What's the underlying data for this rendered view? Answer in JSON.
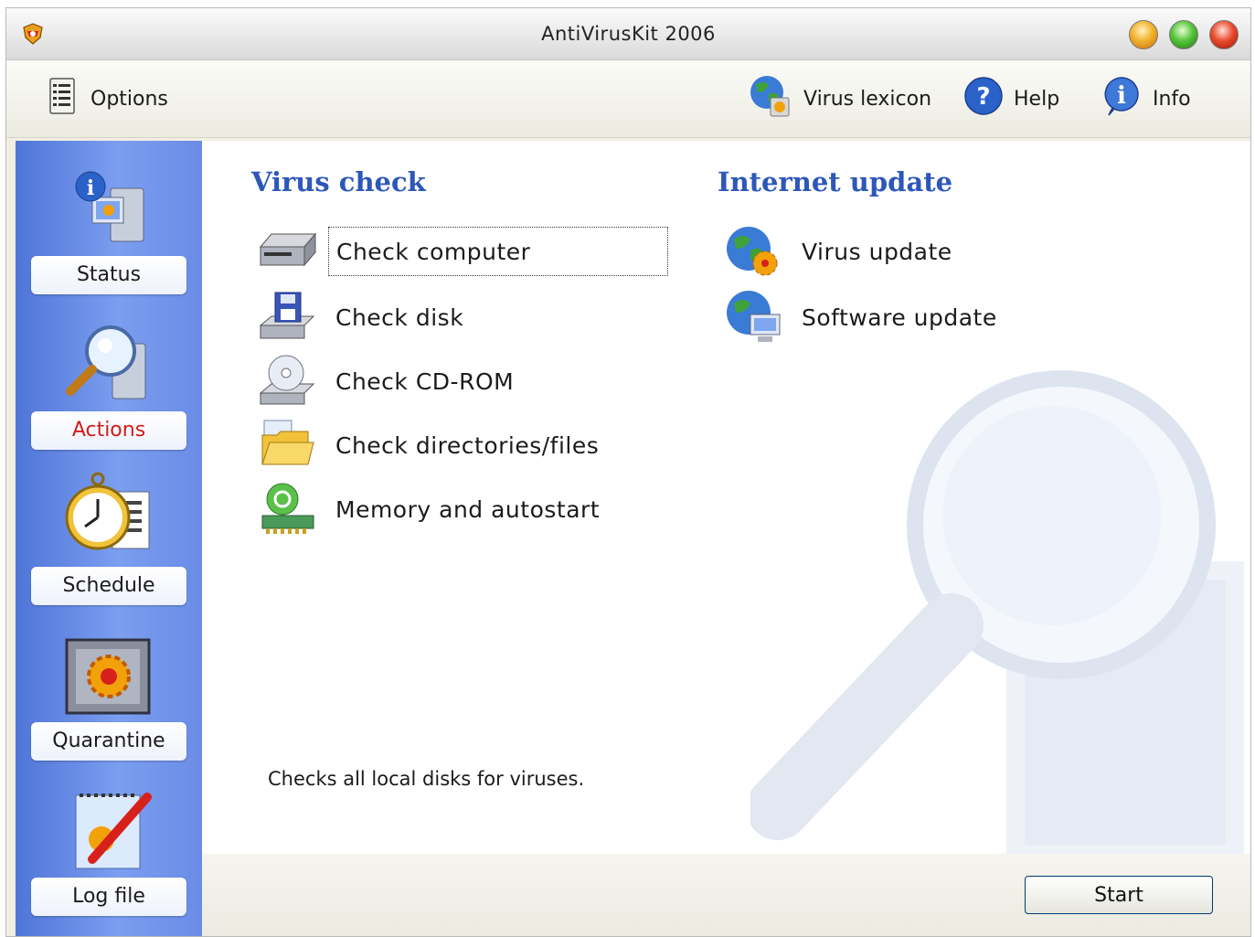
{
  "window": {
    "title": "AntiVirusKit 2006",
    "controls": [
      "minimize",
      "maximize",
      "close"
    ]
  },
  "toolbar": {
    "options_label": "Options",
    "virus_lexicon_label": "Virus lexicon",
    "help_label": "Help",
    "info_label": "Info"
  },
  "sidebar": {
    "items": [
      {
        "label": "Status",
        "icon": "status-icon",
        "active": false
      },
      {
        "label": "Actions",
        "icon": "magnifier-computer-icon",
        "active": true
      },
      {
        "label": "Schedule",
        "icon": "stopwatch-icon",
        "active": false
      },
      {
        "label": "Quarantine",
        "icon": "quarantine-box-icon",
        "active": false
      },
      {
        "label": "Log file",
        "icon": "notepad-pencil-icon",
        "active": false
      }
    ]
  },
  "virus_check": {
    "title": "Virus check",
    "items": [
      {
        "label": "Check computer",
        "icon": "hard-drive-icon",
        "selected": true
      },
      {
        "label": "Check disk",
        "icon": "floppy-disk-icon"
      },
      {
        "label": "Check CD-ROM",
        "icon": "cd-rom-icon"
      },
      {
        "label": "Check directories/files",
        "icon": "folder-icon"
      },
      {
        "label": "Memory and autostart",
        "icon": "memory-chip-icon"
      }
    ]
  },
  "internet_update": {
    "title": "Internet update",
    "items": [
      {
        "label": "Virus update",
        "icon": "globe-virus-icon"
      },
      {
        "label": "Software update",
        "icon": "globe-computer-icon"
      }
    ]
  },
  "description": "Checks all local disks for viruses.",
  "buttons": {
    "start_label": "Start"
  },
  "colors": {
    "sidebar_blue": "#6a8ce6",
    "section_title": "#2d57b8",
    "active_nav_text": "#d21b1b"
  }
}
